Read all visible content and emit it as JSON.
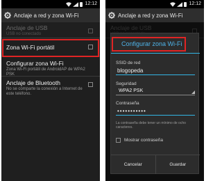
{
  "status_bar": {
    "time": "12:12"
  },
  "header": {
    "title": "Anclaje a red y zona Wi-Fi"
  },
  "settings": {
    "items": [
      {
        "title": "Anclaje de USB",
        "subtitle": "USB no conectado"
      },
      {
        "title": "Zona Wi-Fi portátil",
        "subtitle": ""
      },
      {
        "title": "Configurar zona Wi-Fi",
        "subtitle": "Zona Wi-Fi portátil de AndroidAP de WPA2 PSK"
      },
      {
        "title": "Anclaje de Bluetooth",
        "subtitle": "No se comparte la conexión a Internet de este teléfono."
      }
    ]
  },
  "dialog": {
    "title": "Configurar zona Wi-Fi",
    "ssid_label": "SSID de red",
    "ssid_value": "blogopeda",
    "security_label": "Seguridad",
    "security_value": "WPA2 PSK",
    "password_label": "Contraseña",
    "password_value": "•••••••••••",
    "hint": "La contraseña debe tener un mínimo de ocho caracteres.",
    "show_password_label": "Mostrar contraseña",
    "cancel_label": "Cancelar",
    "save_label": "Guardar"
  },
  "colors": {
    "highlight": "#e02424",
    "accent": "#33b5e5"
  }
}
